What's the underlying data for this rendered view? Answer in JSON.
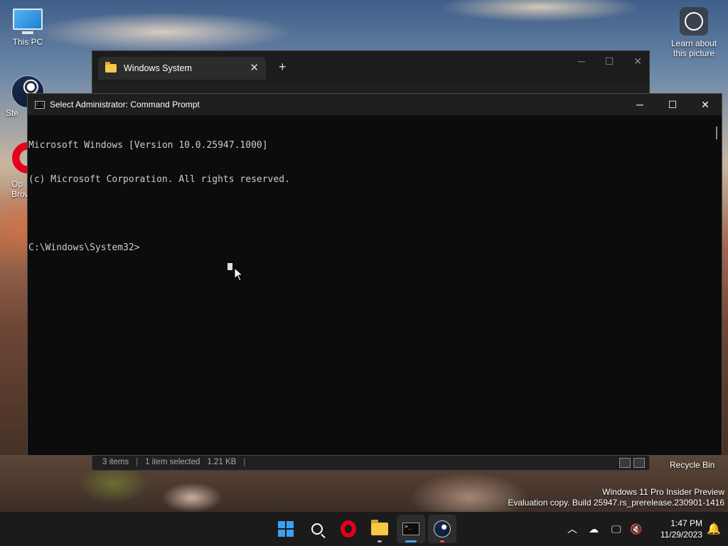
{
  "desktop": {
    "icons": [
      {
        "label": "This PC"
      },
      {
        "label": "Ste"
      },
      {
        "label": "Op\nBrow"
      }
    ],
    "learn_label": "Learn about this picture",
    "recycle_label": "Recycle Bin"
  },
  "explorer": {
    "tab_title": "Windows System",
    "tab_close": "✕",
    "new_tab": "+",
    "status_items": "3 items",
    "status_selected": "1 item selected",
    "status_size": "1.21 KB"
  },
  "cmd": {
    "title": "Select Administrator: Command Prompt",
    "lines": [
      "Microsoft Windows [Version 10.0.25947.1000]",
      "(c) Microsoft Corporation. All rights reserved.",
      "",
      "C:\\Windows\\System32>"
    ],
    "minimize": "─",
    "maximize": "☐",
    "close": "✕"
  },
  "watermark": {
    "line1": "Windows 11 Pro Insider Preview",
    "line2": "Evaluation copy. Build 25947.rs_prerelease.230901-1416"
  },
  "taskbar": {
    "apps": [
      "start-icon",
      "search-icon",
      "opera-icon",
      "file-explorer-icon",
      "terminal-icon",
      "steam-icon"
    ],
    "accent": "#3aa0f3",
    "time": "1:47 PM",
    "date": "11/29/2023",
    "tray_chevron": "^"
  }
}
